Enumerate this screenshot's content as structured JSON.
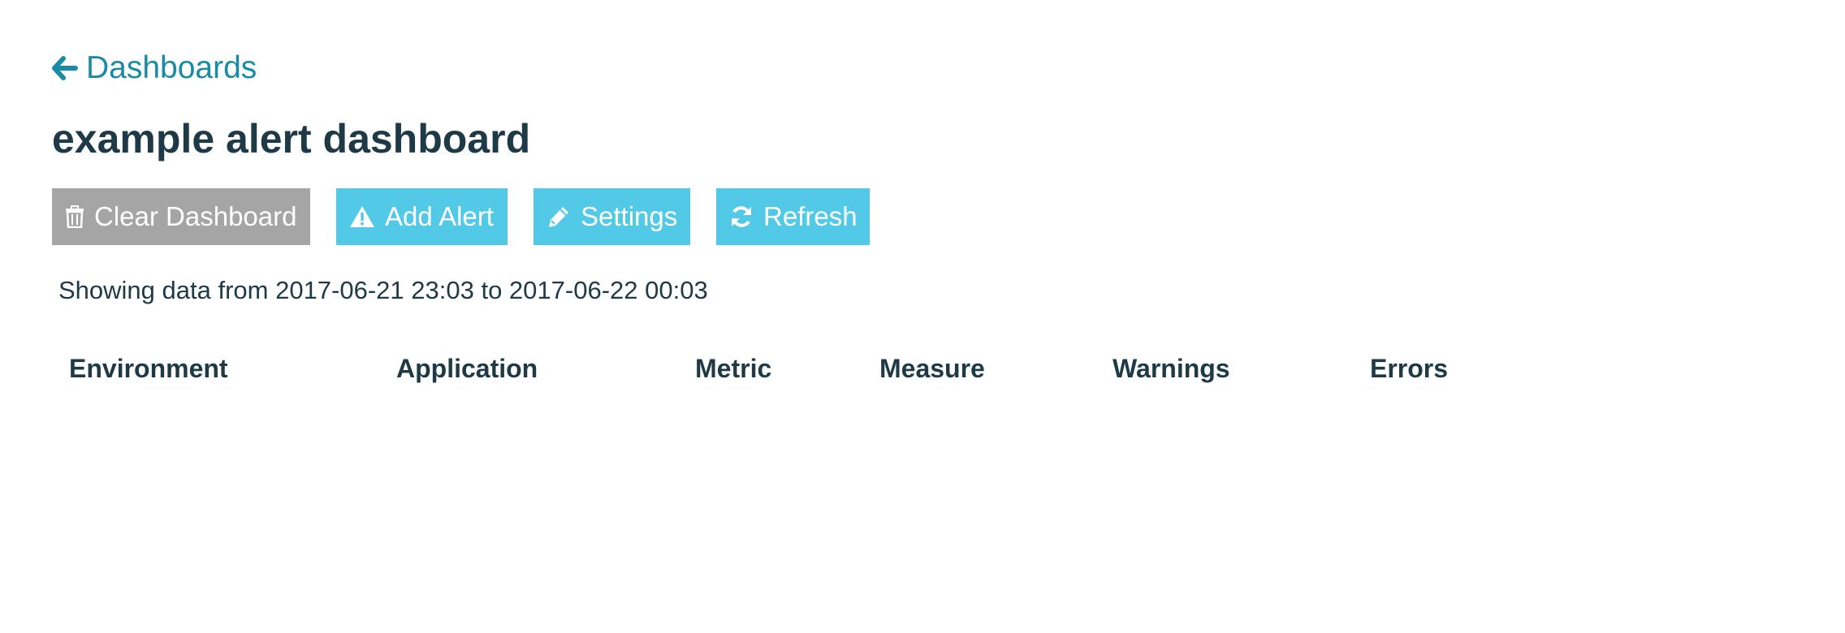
{
  "nav": {
    "back_label": "Dashboards",
    "back_icon": "arrow-left-icon"
  },
  "dashboard": {
    "title": "example alert dashboard"
  },
  "toolbar": {
    "clear_label": "Clear Dashboard",
    "clear_icon": "trash-icon",
    "add_alert_label": "Add Alert",
    "add_alert_icon": "warning-icon",
    "settings_label": "Settings",
    "settings_icon": "pencil-icon",
    "refresh_label": "Refresh",
    "refresh_icon": "refresh-icon"
  },
  "range": {
    "text": "Showing data from 2017-06-21 23:03 to 2017-06-22 00:03"
  },
  "table": {
    "columns": [
      "Environment",
      "Application",
      "Metric",
      "Measure",
      "Warnings",
      "Errors"
    ],
    "rows": []
  },
  "colors": {
    "link": "#1a8ba6",
    "primary_button": "#52c9e7",
    "danger_button": "#a5a5a5",
    "text": "#1f3a47"
  }
}
